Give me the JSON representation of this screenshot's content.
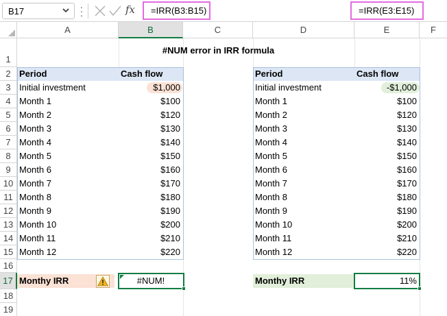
{
  "formula_bar": {
    "name_box": "B17",
    "formula_left": "=IRR(B3:B15)",
    "formula_right": "=IRR(E3:E15)"
  },
  "columns": [
    "A",
    "B",
    "C",
    "D",
    "E",
    "F"
  ],
  "rows": [
    "1",
    "2",
    "3",
    "4",
    "5",
    "6",
    "7",
    "8",
    "9",
    "10",
    "11",
    "12",
    "13",
    "14",
    "15",
    "16",
    "17",
    "18",
    "19"
  ],
  "sheet": {
    "title": "#NUM error in IRR formula",
    "left_table": {
      "headers": [
        "Period",
        "Cash flow"
      ],
      "rows": [
        [
          "Initial investment",
          "$1,000"
        ],
        [
          "Month 1",
          "$100"
        ],
        [
          "Month 2",
          "$120"
        ],
        [
          "Month 3",
          "$130"
        ],
        [
          "Month 4",
          "$140"
        ],
        [
          "Month 5",
          "$150"
        ],
        [
          "Month 6",
          "$160"
        ],
        [
          "Month 7",
          "$170"
        ],
        [
          "Month 8",
          "$180"
        ],
        [
          "Month 9",
          "$190"
        ],
        [
          "Month 10",
          "$200"
        ],
        [
          "Month 11",
          "$210"
        ],
        [
          "Month 12",
          "$220"
        ]
      ],
      "result_label": "Monthy IRR",
      "result_value": "#NUM!"
    },
    "right_table": {
      "headers": [
        "Period",
        "Cash flow"
      ],
      "rows": [
        [
          "Initial investment",
          "-$1,000"
        ],
        [
          "Month 1",
          "$100"
        ],
        [
          "Month 2",
          "$120"
        ],
        [
          "Month 3",
          "$130"
        ],
        [
          "Month 4",
          "$140"
        ],
        [
          "Month 5",
          "$150"
        ],
        [
          "Month 6",
          "$160"
        ],
        [
          "Month 7",
          "$170"
        ],
        [
          "Month 8",
          "$180"
        ],
        [
          "Month 9",
          "$190"
        ],
        [
          "Month 10",
          "$200"
        ],
        [
          "Month 11",
          "$210"
        ],
        [
          "Month 12",
          "$220"
        ]
      ],
      "result_label": "Monthy IRR",
      "result_value": "11%"
    }
  },
  "colors": {
    "header_fill": "#dce6f4",
    "error_label_fill": "#fbe2d5",
    "ok_label_fill": "#e2efda",
    "highlight_frame": "#e36be0",
    "selection": "#107c41"
  },
  "icons": {
    "name_box_dropdown": "chevron-down-icon",
    "cancel": "cancel-x-icon",
    "enter": "checkmark-icon",
    "insert_function": "fx-icon",
    "error_warning": "warning-icon"
  }
}
